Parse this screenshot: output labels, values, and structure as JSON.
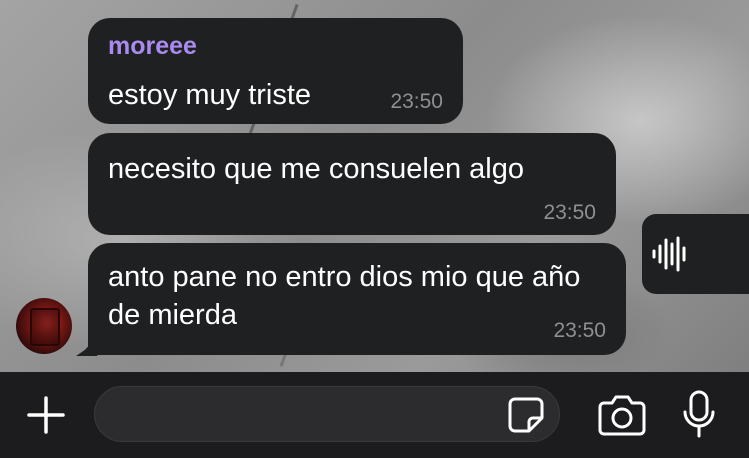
{
  "messages": [
    {
      "sender": "moreee",
      "text": "estoy muy triste",
      "time": "23:50"
    },
    {
      "text": "necesito que me consuelen algo",
      "time": "23:50"
    },
    {
      "text": "anto pane no entro dios mio que año de mierda",
      "time": "23:50"
    }
  ],
  "composer": {
    "placeholder": ""
  },
  "colors": {
    "bubble": "#1f2022",
    "sender_name": "#a98bf0",
    "timestamp": "#8f8f94",
    "composer_bar": "#1c1c1e"
  },
  "icons": {
    "voice_chat": "waveform-icon",
    "attach": "plus-icon",
    "sticker": "sticker-icon",
    "camera": "camera-icon",
    "mic": "microphone-icon"
  }
}
